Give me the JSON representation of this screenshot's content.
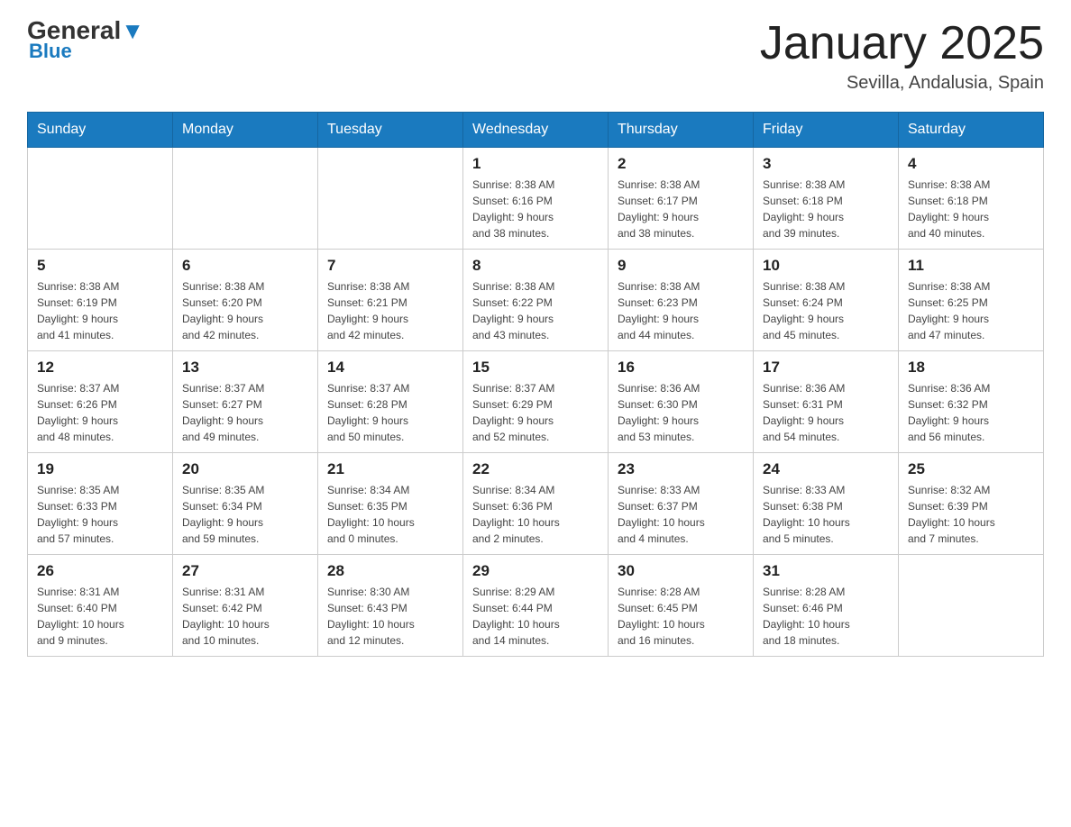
{
  "header": {
    "logo_general": "General",
    "logo_blue": "Blue",
    "month_title": "January 2025",
    "subtitle": "Sevilla, Andalusia, Spain"
  },
  "weekdays": [
    "Sunday",
    "Monday",
    "Tuesday",
    "Wednesday",
    "Thursday",
    "Friday",
    "Saturday"
  ],
  "weeks": [
    [
      {
        "day": "",
        "info": ""
      },
      {
        "day": "",
        "info": ""
      },
      {
        "day": "",
        "info": ""
      },
      {
        "day": "1",
        "info": "Sunrise: 8:38 AM\nSunset: 6:16 PM\nDaylight: 9 hours\nand 38 minutes."
      },
      {
        "day": "2",
        "info": "Sunrise: 8:38 AM\nSunset: 6:17 PM\nDaylight: 9 hours\nand 38 minutes."
      },
      {
        "day": "3",
        "info": "Sunrise: 8:38 AM\nSunset: 6:18 PM\nDaylight: 9 hours\nand 39 minutes."
      },
      {
        "day": "4",
        "info": "Sunrise: 8:38 AM\nSunset: 6:18 PM\nDaylight: 9 hours\nand 40 minutes."
      }
    ],
    [
      {
        "day": "5",
        "info": "Sunrise: 8:38 AM\nSunset: 6:19 PM\nDaylight: 9 hours\nand 41 minutes."
      },
      {
        "day": "6",
        "info": "Sunrise: 8:38 AM\nSunset: 6:20 PM\nDaylight: 9 hours\nand 42 minutes."
      },
      {
        "day": "7",
        "info": "Sunrise: 8:38 AM\nSunset: 6:21 PM\nDaylight: 9 hours\nand 42 minutes."
      },
      {
        "day": "8",
        "info": "Sunrise: 8:38 AM\nSunset: 6:22 PM\nDaylight: 9 hours\nand 43 minutes."
      },
      {
        "day": "9",
        "info": "Sunrise: 8:38 AM\nSunset: 6:23 PM\nDaylight: 9 hours\nand 44 minutes."
      },
      {
        "day": "10",
        "info": "Sunrise: 8:38 AM\nSunset: 6:24 PM\nDaylight: 9 hours\nand 45 minutes."
      },
      {
        "day": "11",
        "info": "Sunrise: 8:38 AM\nSunset: 6:25 PM\nDaylight: 9 hours\nand 47 minutes."
      }
    ],
    [
      {
        "day": "12",
        "info": "Sunrise: 8:37 AM\nSunset: 6:26 PM\nDaylight: 9 hours\nand 48 minutes."
      },
      {
        "day": "13",
        "info": "Sunrise: 8:37 AM\nSunset: 6:27 PM\nDaylight: 9 hours\nand 49 minutes."
      },
      {
        "day": "14",
        "info": "Sunrise: 8:37 AM\nSunset: 6:28 PM\nDaylight: 9 hours\nand 50 minutes."
      },
      {
        "day": "15",
        "info": "Sunrise: 8:37 AM\nSunset: 6:29 PM\nDaylight: 9 hours\nand 52 minutes."
      },
      {
        "day": "16",
        "info": "Sunrise: 8:36 AM\nSunset: 6:30 PM\nDaylight: 9 hours\nand 53 minutes."
      },
      {
        "day": "17",
        "info": "Sunrise: 8:36 AM\nSunset: 6:31 PM\nDaylight: 9 hours\nand 54 minutes."
      },
      {
        "day": "18",
        "info": "Sunrise: 8:36 AM\nSunset: 6:32 PM\nDaylight: 9 hours\nand 56 minutes."
      }
    ],
    [
      {
        "day": "19",
        "info": "Sunrise: 8:35 AM\nSunset: 6:33 PM\nDaylight: 9 hours\nand 57 minutes."
      },
      {
        "day": "20",
        "info": "Sunrise: 8:35 AM\nSunset: 6:34 PM\nDaylight: 9 hours\nand 59 minutes."
      },
      {
        "day": "21",
        "info": "Sunrise: 8:34 AM\nSunset: 6:35 PM\nDaylight: 10 hours\nand 0 minutes."
      },
      {
        "day": "22",
        "info": "Sunrise: 8:34 AM\nSunset: 6:36 PM\nDaylight: 10 hours\nand 2 minutes."
      },
      {
        "day": "23",
        "info": "Sunrise: 8:33 AM\nSunset: 6:37 PM\nDaylight: 10 hours\nand 4 minutes."
      },
      {
        "day": "24",
        "info": "Sunrise: 8:33 AM\nSunset: 6:38 PM\nDaylight: 10 hours\nand 5 minutes."
      },
      {
        "day": "25",
        "info": "Sunrise: 8:32 AM\nSunset: 6:39 PM\nDaylight: 10 hours\nand 7 minutes."
      }
    ],
    [
      {
        "day": "26",
        "info": "Sunrise: 8:31 AM\nSunset: 6:40 PM\nDaylight: 10 hours\nand 9 minutes."
      },
      {
        "day": "27",
        "info": "Sunrise: 8:31 AM\nSunset: 6:42 PM\nDaylight: 10 hours\nand 10 minutes."
      },
      {
        "day": "28",
        "info": "Sunrise: 8:30 AM\nSunset: 6:43 PM\nDaylight: 10 hours\nand 12 minutes."
      },
      {
        "day": "29",
        "info": "Sunrise: 8:29 AM\nSunset: 6:44 PM\nDaylight: 10 hours\nand 14 minutes."
      },
      {
        "day": "30",
        "info": "Sunrise: 8:28 AM\nSunset: 6:45 PM\nDaylight: 10 hours\nand 16 minutes."
      },
      {
        "day": "31",
        "info": "Sunrise: 8:28 AM\nSunset: 6:46 PM\nDaylight: 10 hours\nand 18 minutes."
      },
      {
        "day": "",
        "info": ""
      }
    ]
  ]
}
